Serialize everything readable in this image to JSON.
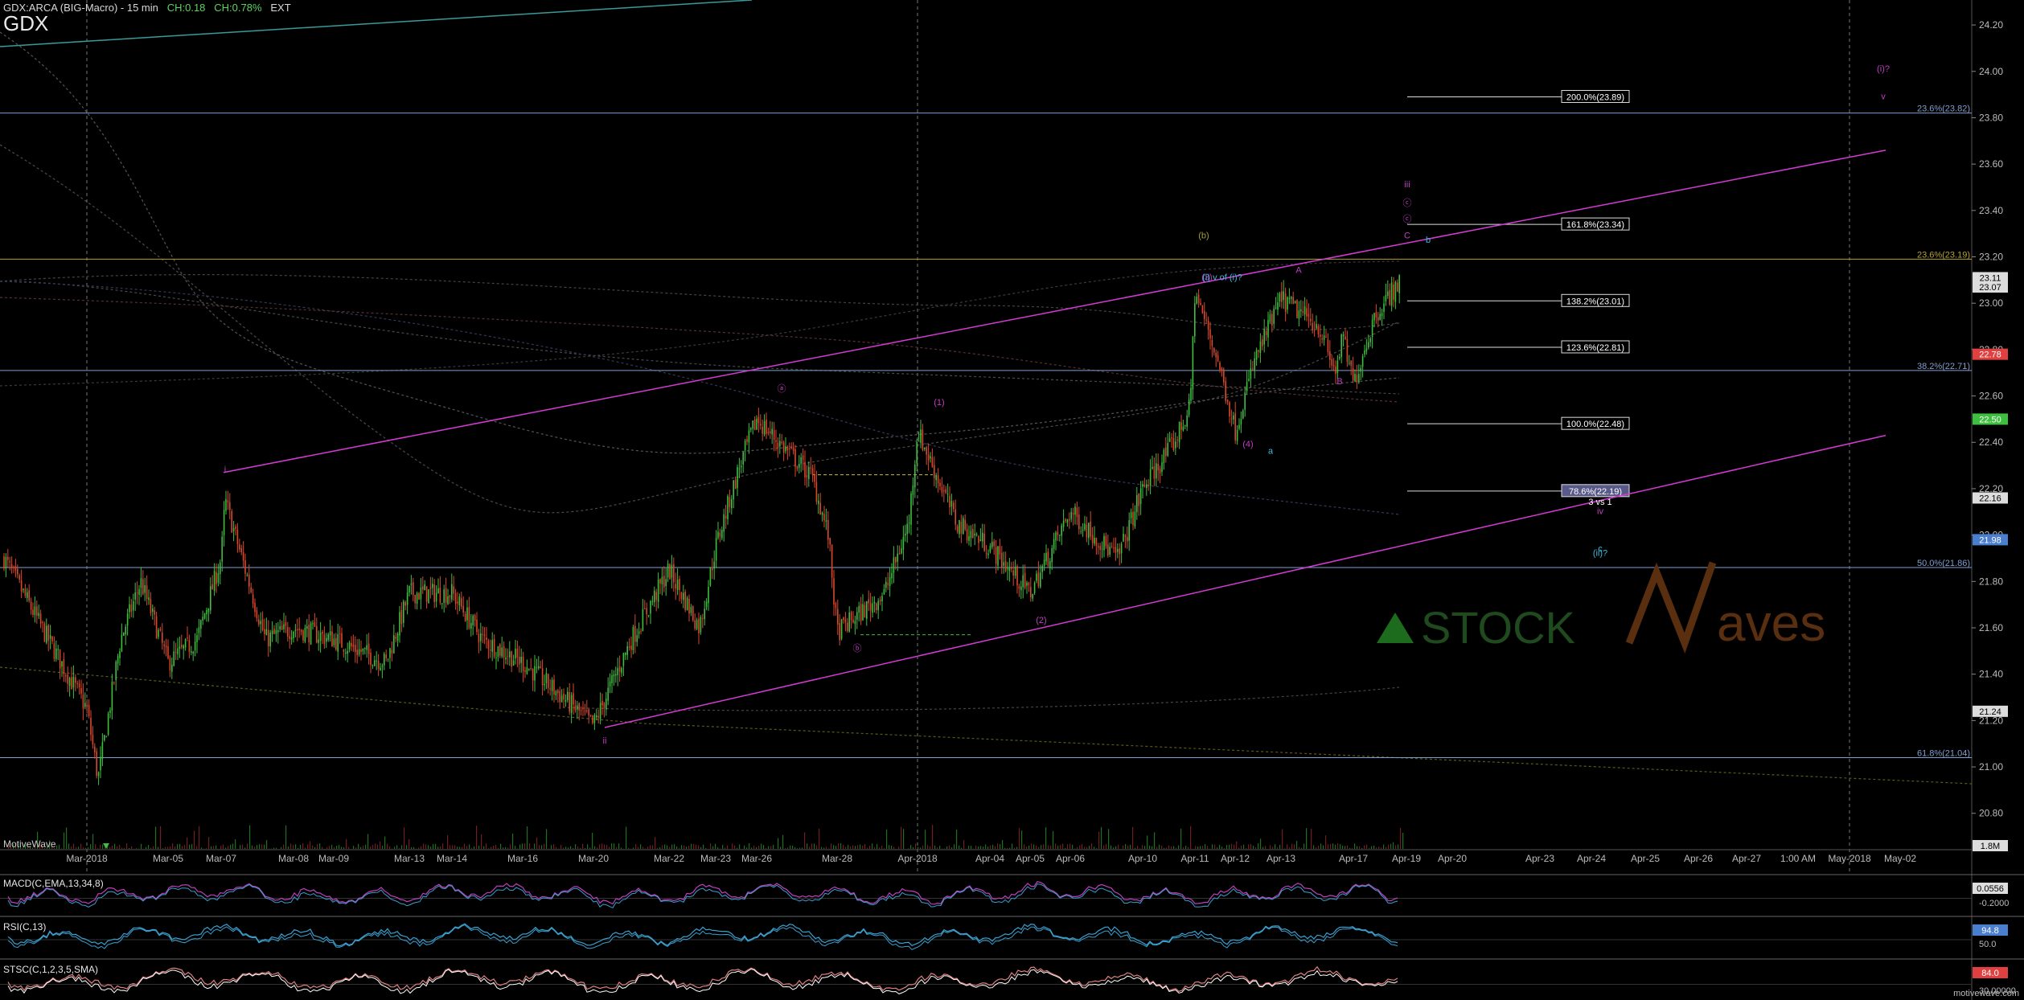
{
  "header": {
    "instrument": "GDX:ARCA (BIG-Macro) - 15 min",
    "change": "CH:0.18",
    "change_pct": "CH:0.78%",
    "session": "EXT",
    "symbol": "GDX"
  },
  "brand": "MotiveWave",
  "footer": "motivewave.com",
  "colors": {
    "background": "#000000",
    "up_candle": "#3fbf3f",
    "down_candle": "#d9482b",
    "channel": "#d43bd4",
    "fib_line": "#7f9fcf",
    "fib_gold": "#b5a22e",
    "wave_cyan": "#3fb8d8",
    "wave_magenta": "#c23ec2",
    "wave_olive": "#9f9f3f"
  },
  "chart_data": {
    "type": "candlestick",
    "title": "GDX",
    "timeframe": "15 min",
    "ylim": [
      20.65,
      24.28
    ],
    "y_ticks": [
      "24.20",
      "24.00",
      "23.80",
      "23.60",
      "23.40",
      "23.20",
      "23.00",
      "22.80",
      "22.60",
      "22.40",
      "22.20",
      "22.00",
      "21.80",
      "21.60",
      "21.40",
      "21.20",
      "21.00",
      "20.80"
    ],
    "x_ticks": [
      "Mar-2018",
      "Mar-05",
      "Mar-07",
      "Mar-08",
      "Mar-09",
      "Mar-13",
      "Mar-14",
      "Mar-16",
      "Mar-20",
      "Mar-22",
      "Mar-23",
      "Mar-26",
      "Mar-28",
      "Apr-2018",
      "Apr-04",
      "Apr-05",
      "Apr-06",
      "Apr-10",
      "Apr-11",
      "Apr-12",
      "Apr-13",
      "Apr-17",
      "Apr-19",
      "Apr-20",
      "Apr-23",
      "Apr-24",
      "Apr-25",
      "Apr-26",
      "Apr-27",
      "1:00 AM",
      "May-2018",
      "May-02"
    ],
    "price_path": [
      {
        "x": "Feb-28",
        "y": 21.9
      },
      {
        "x": "Mar-01a",
        "y": 21.55
      },
      {
        "x": "Mar-2018",
        "y": 21.25
      },
      {
        "x": "Mar-01b",
        "y": 20.95
      },
      {
        "x": "Mar-02a",
        "y": 21.55
      },
      {
        "x": "Mar-02b",
        "y": 21.8
      },
      {
        "x": "Mar-05",
        "y": 21.45
      },
      {
        "x": "Mar-06",
        "y": 21.55
      },
      {
        "x": "Mar-06b",
        "y": 22.15
      },
      {
        "x": "Mar-07",
        "y": 21.9
      },
      {
        "x": "Mar-07b",
        "y": 21.55
      },
      {
        "x": "Mar-08",
        "y": 21.6
      },
      {
        "x": "Mar-09",
        "y": 21.55
      },
      {
        "x": "Mar-12",
        "y": 21.45
      },
      {
        "x": "Mar-13",
        "y": 21.75
      },
      {
        "x": "Mar-14",
        "y": 21.75
      },
      {
        "x": "Mar-15",
        "y": 21.55
      },
      {
        "x": "Mar-16",
        "y": 21.45
      },
      {
        "x": "Mar-19",
        "y": 21.3
      },
      {
        "x": "Mar-20",
        "y": 21.18
      },
      {
        "x": "Mar-21",
        "y": 21.55
      },
      {
        "x": "Mar-22",
        "y": 21.85
      },
      {
        "x": "Mar-22b",
        "y": 21.6
      },
      {
        "x": "Mar-23",
        "y": 21.95
      },
      {
        "x": "Mar-26a",
        "y": 22.3
      },
      {
        "x": "Mar-26",
        "y": 22.5
      },
      {
        "x": "Mar-27a",
        "y": 22.25
      },
      {
        "x": "Mar-27b",
        "y": 22.0
      },
      {
        "x": "Mar-28",
        "y": 21.58
      },
      {
        "x": "Mar-29",
        "y": 21.75
      },
      {
        "x": "Mar-29b",
        "y": 22.05
      },
      {
        "x": "Apr-2018",
        "y": 22.45
      },
      {
        "x": "Apr-03",
        "y": 22.05
      },
      {
        "x": "Apr-04",
        "y": 21.95
      },
      {
        "x": "Apr-05",
        "y": 21.75
      },
      {
        "x": "Apr-06",
        "y": 22.1
      },
      {
        "x": "Apr-09",
        "y": 21.9
      },
      {
        "x": "Apr-10",
        "y": 22.2
      },
      {
        "x": "Apr-10b",
        "y": 22.4
      },
      {
        "x": "Apr-11a",
        "y": 22.55
      },
      {
        "x": "Apr-11",
        "y": 23.05
      },
      {
        "x": "Apr-11b",
        "y": 22.75
      },
      {
        "x": "Apr-12",
        "y": 22.45
      },
      {
        "x": "Apr-12b",
        "y": 22.75
      },
      {
        "x": "Apr-13",
        "y": 23.02
      },
      {
        "x": "Apr-16",
        "y": 22.9
      },
      {
        "x": "Apr-16b",
        "y": 22.7
      },
      {
        "x": "Apr-17a",
        "y": 22.85
      },
      {
        "x": "Apr-17",
        "y": 22.65
      },
      {
        "x": "Apr-17b",
        "y": 22.95
      },
      {
        "x": "Apr-18",
        "y": 23.1
      }
    ],
    "fib_levels": [
      {
        "label": "23.6%(23.82)",
        "value": 23.82
      },
      {
        "label": "23.6%(23.19)",
        "value": 23.19
      },
      {
        "label": "38.2%(22.71)",
        "value": 22.71
      },
      {
        "label": "50.0%(21.86)",
        "value": 21.86
      },
      {
        "label": "61.8%(21.04)",
        "value": 21.04
      }
    ],
    "projections": [
      {
        "label": "200.0%(23.89)",
        "value": 23.89
      },
      {
        "label": "161.8%(23.34)",
        "value": 23.34
      },
      {
        "label": "138.2%(23.01)",
        "value": 23.01
      },
      {
        "label": "123.6%(22.81)",
        "value": 22.81
      },
      {
        "label": "100.0%(22.48)",
        "value": 22.48
      },
      {
        "label": "78.6%(22.19)",
        "value": 22.19
      }
    ],
    "right_badges": [
      {
        "label": "23.11",
        "value": 23.11,
        "color": "#dddddd"
      },
      {
        "label": "23.07",
        "value": 23.07,
        "color": "#dddddd"
      },
      {
        "label": "22.78",
        "value": 22.78,
        "color": "#e04040"
      },
      {
        "label": "22.50",
        "value": 22.5,
        "color": "#3fbf3f"
      },
      {
        "label": "22.16",
        "value": 22.16,
        "color": "#dddddd"
      },
      {
        "label": "21.98",
        "value": 21.98,
        "color": "#4a7fd0"
      },
      {
        "label": "21.24",
        "value": 21.24,
        "color": "#dddddd"
      }
    ],
    "wave_labels": [
      {
        "text": "i",
        "x": "Mar-06b",
        "y": 22.27,
        "color": "#c23ec2"
      },
      {
        "text": "ii",
        "x": "Mar-20",
        "y": 21.1,
        "color": "#c23ec2"
      },
      {
        "text": "ⓐ",
        "x": "Mar-26",
        "y": 22.62,
        "color": "#c23ec2"
      },
      {
        "text": "ⓑ",
        "x": "Mar-28",
        "y": 21.5,
        "color": "#c23ec2"
      },
      {
        "text": "(1)",
        "x": "Apr-2018",
        "y": 22.56,
        "color": "#c23ec2"
      },
      {
        "text": "(2)",
        "x": "Apr-05",
        "y": 21.62,
        "color": "#c23ec2"
      },
      {
        "text": "(3)",
        "x": "Apr-11",
        "y": 23.1,
        "color": "#c23ec2"
      },
      {
        "text": "(4)",
        "x": "Apr-12",
        "y": 22.38,
        "color": "#c23ec2"
      },
      {
        "text": "(b)",
        "x": "Apr-10b",
        "y": 23.28,
        "color": "#9f9f3f"
      },
      {
        "text": "(i) v of (i)?",
        "x": "Apr-11b",
        "y": 23.1,
        "color": "#3fb8d8"
      },
      {
        "text": "A",
        "x": "Apr-13",
        "y": 23.13,
        "color": "#c23ec2"
      },
      {
        "text": "B",
        "x": "Apr-17",
        "y": 22.65,
        "color": "#c23ec2"
      },
      {
        "text": "a",
        "x": "Apr-12b",
        "y": 22.35,
        "color": "#3fb8d8"
      },
      {
        "text": "iii",
        "x": "Apr-18",
        "y": 23.5,
        "color": "#c23ec2"
      },
      {
        "text": "ⓒ",
        "x": "Apr-18",
        "y": 23.42,
        "color": "#c23ec2"
      },
      {
        "text": "ⓒ",
        "x": "Apr-18",
        "y": 23.35,
        "color": "#c23ec2"
      },
      {
        "text": "C",
        "x": "Apr-18",
        "y": 23.28,
        "color": "#c23ec2"
      },
      {
        "text": "b",
        "x": "Apr-19",
        "y": 23.26,
        "color": "#3fb8d8"
      },
      {
        "text": "3 vs 1",
        "x": "Apr-20",
        "y": 22.13,
        "color": "#ffffff"
      },
      {
        "text": "iv",
        "x": "Apr-20",
        "y": 22.09,
        "color": "#c23ec2"
      },
      {
        "text": "c",
        "x": "Apr-20",
        "y": 21.93,
        "color": "#3fb8d8"
      },
      {
        "text": "(ii)?",
        "x": "Apr-20",
        "y": 21.91,
        "color": "#3fb8d8"
      },
      {
        "text": "(i)?",
        "x": "May-02",
        "y": 24.0,
        "color": "#c23ec2"
      },
      {
        "text": "v",
        "x": "May-02",
        "y": 23.88,
        "color": "#c23ec2"
      }
    ],
    "volume_label": "1.8M",
    "watermark": "STOCKWaves",
    "indicators": [
      {
        "name": "MACD(C,EMA,13,34,8)",
        "badge": "0.0556",
        "ticks": [
          "-0.2000"
        ]
      },
      {
        "name": "RSI(C,13)",
        "badge": "94.8",
        "ticks": [
          "50.0"
        ]
      },
      {
        "name": "STSC(C,1,2,3,5,SMA)",
        "badge": "84.0",
        "ticks": [
          "30.00000"
        ]
      }
    ]
  }
}
